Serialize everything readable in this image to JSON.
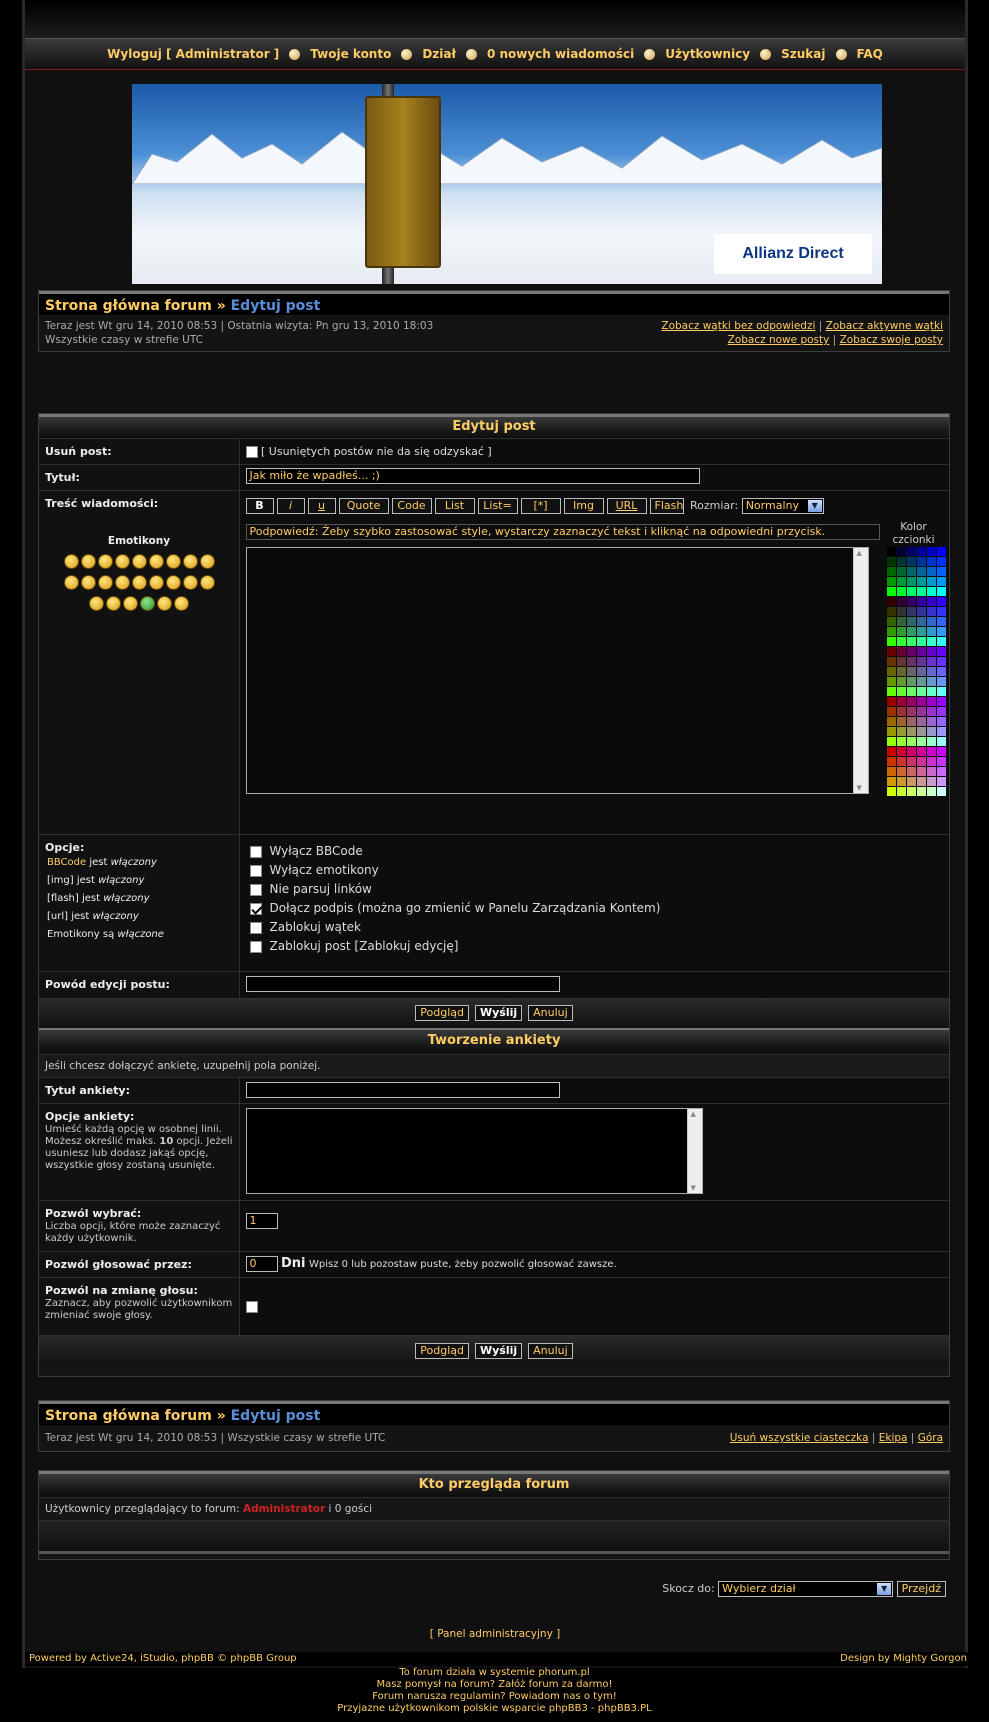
{
  "nav": {
    "logout": "Wyloguj [ Administrator ]",
    "account": "Twoje konto",
    "section": "Dział",
    "new_messages": "0 nowych wiadomości",
    "users": "Użytkownicy",
    "search": "Szukaj",
    "faq": "FAQ"
  },
  "banner": {
    "brand": "Allianz Direct"
  },
  "breadcrumb": {
    "home": "Strona główna forum",
    "sep": "»",
    "current": "Edytuj post"
  },
  "info": {
    "now": "Teraz jest Wt gru 14, 2010 08:53 | Ostatnia wizyta: Pn gru 13, 2010 18:03",
    "tz": "Wszystkie czasy w strefie UTC",
    "unanswered": "Zobacz wątki bez odpowiedzi",
    "active": "Zobacz aktywne wątki",
    "new_posts": "Zobacz nowe posty",
    "your_posts": "Zobacz swoje posty"
  },
  "edit": {
    "title": "Edytuj post",
    "delete_label": "Usuń post:",
    "delete_note": "[ Usuniętych postów nie da się odzyskać ]",
    "subject_label": "Tytuł:",
    "subject_value": "Jak miło że wpadłeś... ;)",
    "message_label": "Treść wiadomości:",
    "emoticons_label": "Emotikony",
    "toolbar": [
      "B",
      "i",
      "u",
      "Quote",
      "Code",
      "List",
      "List=",
      "[*]",
      "Img",
      "URL",
      "Flash"
    ],
    "size_label": "Rozmiar:",
    "size_value": "Normalny",
    "color_label": "Kolor czcionki",
    "hint": "Podpowiedź: Żeby szybko zastosować style, wystarczy zaznaczyć tekst i kliknąć na odpowiedni przycisk.",
    "options_label": "Opcje:",
    "options_status": {
      "bbcode_a": "BBCode",
      "bbcode_b": "jest",
      "bbcode_c": "włączony",
      "img_a": "[img] jest",
      "img_b": "włączony",
      "flash_a": "[flash] jest",
      "flash_b": "włączony",
      "url_a": "[url] jest",
      "url_b": "włączony",
      "emo_a": "Emotikony są",
      "emo_b": "włączone"
    },
    "options": [
      {
        "label": "Wyłącz BBCode",
        "checked": false
      },
      {
        "label": "Wyłącz emotikony",
        "checked": false
      },
      {
        "label": "Nie parsuj linków",
        "checked": false
      },
      {
        "label": "Dołącz podpis (można go zmienić w Panelu Zarządzania Kontem)",
        "checked": true
      },
      {
        "label": "Zablokuj wątek",
        "checked": false
      },
      {
        "label": "Zablokuj post [Zablokuj edycję]",
        "checked": false
      }
    ],
    "reason_label": "Powód edycji postu:",
    "preview": "Podgląd",
    "submit": "Wyślij",
    "cancel": "Anuluj"
  },
  "poll": {
    "title": "Tworzenie ankiety",
    "intro": "Jeśli chcesz dołączyć ankietę, uzupełnij pola poniżej.",
    "title_label": "Tytuł ankiety:",
    "options_label": "Opcje ankiety:",
    "options_help_a": "Umieść każdą opcję w osobnej linii. Możesz określić maks.",
    "options_help_max": "10",
    "options_help_b": "opcji. Jeżeli usuniesz lub dodasz jakąś opcję, wszystkie głosy zostaną usunięte.",
    "choose_label": "Pozwól wybrać:",
    "choose_help": "Liczba opcji, które może zaznaczyć każdy użytkownik.",
    "choose_value": "1",
    "days_label": "Pozwól głosować przez:",
    "days_value": "0",
    "days_unit": "Dni",
    "days_help": "Wpisz 0 lub pozostaw puste, żeby pozwolić głosować zawsze.",
    "change_label": "Pozwól na zmianę głosu:",
    "change_help": "Zaznacz, aby pozwolić użytkownikom zmieniać swoje głosy."
  },
  "bottom_info": {
    "now": "Teraz jest Wt gru 14, 2010 08:53 | Wszystkie czasy w strefie UTC",
    "cookies": "Usuń wszystkie ciasteczka",
    "team": "Ekipa",
    "top": "Góra"
  },
  "viewers": {
    "title": "Kto przegląda forum",
    "text_a": "Użytkownicy przeglądający to forum:",
    "admin": "Administrator",
    "text_b": "i 0 gości"
  },
  "jump": {
    "label": "Skocz do:",
    "value": "Wybierz dział",
    "go": "Przejdź"
  },
  "admin_panel": "[ Panel administracyjny ]",
  "footer": {
    "left": "Powered by Active24, iStudio, phpBB © phpBB Group",
    "right": "Design by Mighty Gorgon"
  },
  "bottom_lines": [
    "To forum działa w systemie phorum.pl",
    "Masz pomysł na forum? Załóż forum za darmo!",
    "Forum narusza regulamin? Powiadom nas o tym!",
    "Przyjazne użytkownikom polskie wsparcie phpBB3 - phpBB3.PL"
  ],
  "colors": {
    "accent": "#ffcc66",
    "link_current": "#5b8ed8",
    "admin": "#cc2222"
  }
}
